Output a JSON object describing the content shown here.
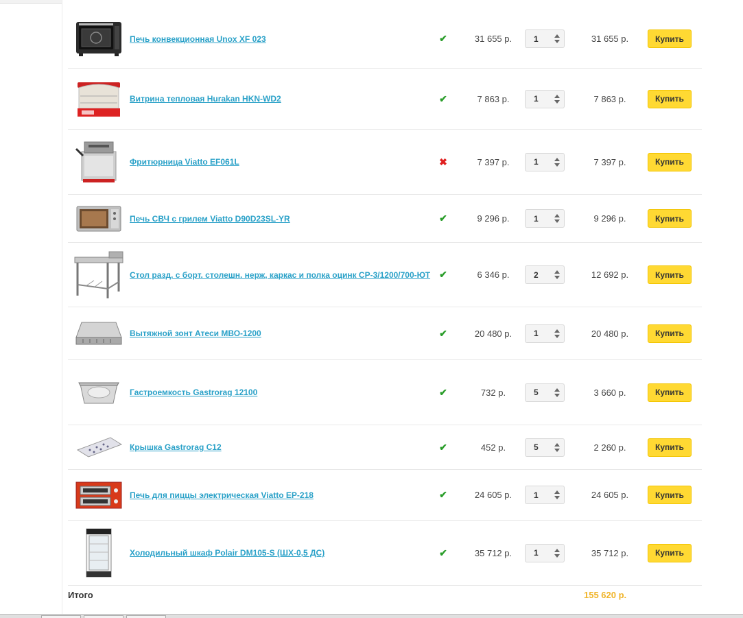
{
  "cart": {
    "items": [
      {
        "name": "Печь конвекционная Unox XF 023",
        "in_stock": true,
        "stock_icon": "check-icon",
        "price": "31 655 р.",
        "qty": "1",
        "sum": "31 655 р.",
        "buy_label": "Купить"
      },
      {
        "name": "Витрина тепловая Hurakan HKN-WD2",
        "in_stock": true,
        "stock_icon": "check-icon",
        "price": "7 863 р.",
        "qty": "1",
        "sum": "7 863 р.",
        "buy_label": "Купить"
      },
      {
        "name": "Фритюрница Viatto EF061L",
        "in_stock": false,
        "stock_icon": "cross-icon",
        "price": "7 397 р.",
        "qty": "1",
        "sum": "7 397 р.",
        "buy_label": "Купить"
      },
      {
        "name": "Печь СВЧ с грилем Viatto D90D23SL-YR",
        "in_stock": true,
        "stock_icon": "check-icon",
        "price": "9 296 р.",
        "qty": "1",
        "sum": "9 296 р.",
        "buy_label": "Купить"
      },
      {
        "name": "Стол разд. с борт. столешн. нерж, каркас и полка оцинк СР-3/1200/700-ЮТ",
        "in_stock": true,
        "stock_icon": "check-icon",
        "price": "6 346 р.",
        "qty": "2",
        "sum": "12 692 р.",
        "buy_label": "Купить"
      },
      {
        "name": "Вытяжной зонт Атеси МВО-1200",
        "in_stock": true,
        "stock_icon": "check-icon",
        "price": "20 480 р.",
        "qty": "1",
        "sum": "20 480 р.",
        "buy_label": "Купить"
      },
      {
        "name": "Гастроемкость Gastrorag 12100",
        "in_stock": true,
        "stock_icon": "check-icon",
        "price": "732 р.",
        "qty": "5",
        "sum": "3 660 р.",
        "buy_label": "Купить"
      },
      {
        "name": "Крышка Gastrorag C12",
        "in_stock": true,
        "stock_icon": "check-icon",
        "price": "452 р.",
        "qty": "5",
        "sum": "2 260 р.",
        "buy_label": "Купить"
      },
      {
        "name": "Печь для пиццы электрическая Viatto EP-218",
        "in_stock": true,
        "stock_icon": "check-icon",
        "price": "24 605 р.",
        "qty": "1",
        "sum": "24 605 р.",
        "buy_label": "Купить"
      },
      {
        "name": "Холодильный шкаф Polair DM105-S (ШХ-0,5 ДС)",
        "in_stock": true,
        "stock_icon": "check-icon",
        "price": "35 712 р.",
        "qty": "1",
        "sum": "35 712 р.",
        "buy_label": "Купить"
      }
    ],
    "total_label": "Итого",
    "total_value": "155 620 р."
  },
  "colors": {
    "link": "#2aa1c8",
    "in_stock": "#2a9d2a",
    "out_of_stock": "#e02020",
    "buy_button": "#ffd933",
    "total": "#f0b429"
  }
}
